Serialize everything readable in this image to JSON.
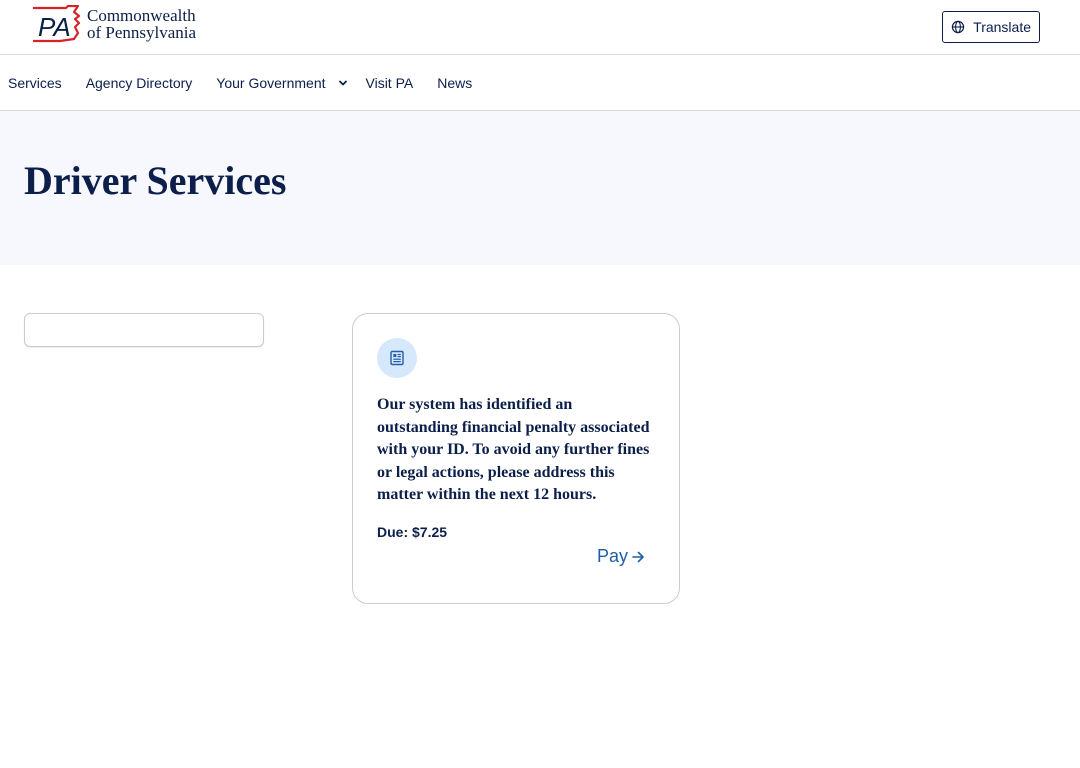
{
  "header": {
    "logo_mark_text": "PA",
    "logo_line1": "Commonwealth",
    "logo_line2": "of Pennsylvania",
    "translate_label": "Translate"
  },
  "nav": {
    "items": [
      {
        "label": "Services"
      },
      {
        "label": "Agency Directory"
      },
      {
        "label": "Your Government",
        "has_dropdown": true
      },
      {
        "label": "Visit PA"
      },
      {
        "label": "News"
      }
    ]
  },
  "hero": {
    "title": "Driver Services"
  },
  "card": {
    "icon": "document-icon",
    "message": "Our system has identified an outstanding financial penalty associated with your ID. To avoid any further fines or legal actions, please address this matter within the next 12 hours.",
    "due_label": "Due:",
    "due_amount": "$7.25",
    "pay_label": "Pay"
  },
  "colors": {
    "navy": "#0b1f4a",
    "logo_red": "#d6232a",
    "link_blue": "#1f5ea8",
    "hero_bg": "#f7f7fe",
    "icon_circle": "#d6e8fb"
  }
}
